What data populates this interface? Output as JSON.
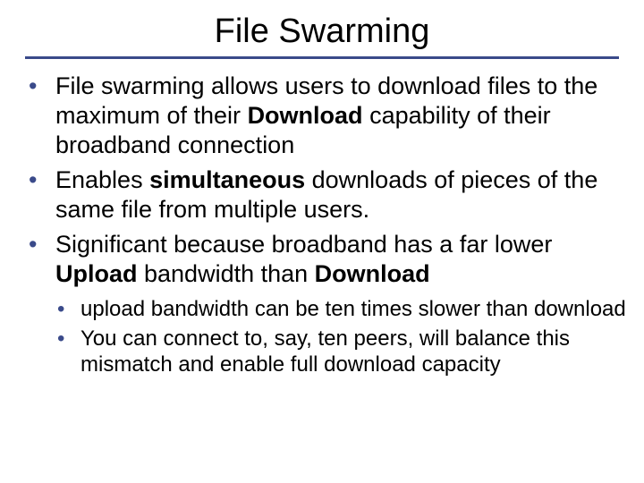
{
  "slide": {
    "title": "File Swarming",
    "bullets": [
      {
        "pre": "File swarming allows users to download files to the maximum of their ",
        "bold1": "Download",
        "post": " capability of their broadband connection"
      },
      {
        "pre": "Enables ",
        "bold1": "simultaneous",
        "post": " downloads of pieces of the same file from multiple users."
      },
      {
        "pre": "Significant because broadband has a far lower ",
        "bold1": "Upload",
        "mid": " bandwidth than ",
        "bold2": "Download",
        "post": ""
      }
    ],
    "subbullets": [
      "upload bandwidth can be ten times slower than download",
      "You can connect to, say, ten peers, will balance this mismatch and enable full download capacity"
    ]
  }
}
